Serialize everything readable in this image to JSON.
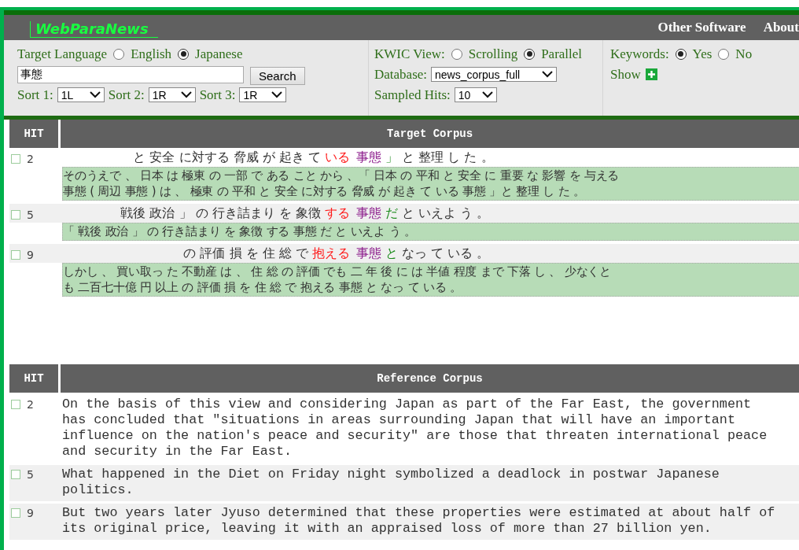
{
  "header": {
    "logo": "WebParaNews",
    "links": [
      {
        "label": "Other Software"
      },
      {
        "label": "About"
      }
    ]
  },
  "controls": {
    "target_language": {
      "label": "Target Language",
      "options": [
        {
          "label": "English",
          "selected": false
        },
        {
          "label": "Japanese",
          "selected": true
        }
      ]
    },
    "search": {
      "value": "事態",
      "button": "Search"
    },
    "sorts": [
      {
        "label": "Sort 1:",
        "value": "1L"
      },
      {
        "label": "Sort 2:",
        "value": "1R"
      },
      {
        "label": "Sort 3:",
        "value": "1R"
      }
    ],
    "kwic_view": {
      "label": "KWIC View:",
      "options": [
        {
          "label": "Scrolling",
          "selected": false
        },
        {
          "label": "Parallel",
          "selected": true
        }
      ]
    },
    "database": {
      "label": "Database:",
      "value": "news_corpus_full"
    },
    "sampled_hits": {
      "label": "Sampled Hits:",
      "value": "10"
    },
    "keywords": {
      "label": "Keywords:",
      "options": [
        {
          "label": "Yes",
          "selected": true
        },
        {
          "label": "No",
          "selected": false
        }
      ]
    },
    "show": {
      "label": "Show"
    }
  },
  "target_table": {
    "columns": [
      "HIT",
      "Target Corpus"
    ],
    "rows": [
      {
        "hit": "2",
        "checked": false,
        "left": "と 安全 に対する 脅威 が 起き て",
        "node": "いる",
        "keyword": "事態",
        "right_first": "」",
        "right": "と 整理 し た 。",
        "sentence": [
          "そのうえで 、 日本 は 極東 の 一部 で ある こと から 、「 日本 の 平和 と 安全 に 重要 な 影響 を 与える",
          "事態 ( 周辺 事態 ) は 、 極東 の 平和 と 安全 に対する 脅威 が 起き て いる 事態 」と 整理 し た 。"
        ]
      },
      {
        "hit": "5",
        "checked": false,
        "left": "戦後 政治 」 の 行き詰まり を 象徴",
        "node": "する",
        "keyword": "事態",
        "right_first": "だ",
        "right": "と いえよ う 。",
        "sentence": [
          "「 戦後 政治 」 の 行き詰まり を 象徴 する 事態 だ と いえよ う 。"
        ]
      },
      {
        "hit": "9",
        "checked": false,
        "left": "の 評価 損 を 住 総 で",
        "node": "抱える",
        "keyword": "事態",
        "right_first": "と",
        "right": "なっ て いる 。",
        "sentence": [
          "しかし 、 買い取っ た 不動産 は 、 住 総 の 評価 でも 二 年 後 に は 半値 程度 まで 下落 し 、 少なくと",
          "も 二百七十億 円 以上 の 評価 損 を 住 総 で 抱える 事態 と なっ て いる 。"
        ]
      }
    ]
  },
  "reference_table": {
    "columns": [
      "HIT",
      "Reference Corpus"
    ],
    "rows": [
      {
        "hit": "2",
        "checked": false,
        "text": "On the basis of this view and considering Japan as part of the Far East, the government has concluded that \"situations in areas surrounding Japan that will have an important influence on the nation's peace and security\" are those that threaten international peace and security in the Far East."
      },
      {
        "hit": "5",
        "checked": false,
        "text": "What happened in the Diet on Friday night symbolized a deadlock in postwar Japanese politics."
      },
      {
        "hit": "9",
        "checked": false,
        "text": "But two years later Jyuso determined that these properties were estimated at about half of its original price, leaving it with an appraised loss of more than 27 billion yen."
      }
    ]
  }
}
